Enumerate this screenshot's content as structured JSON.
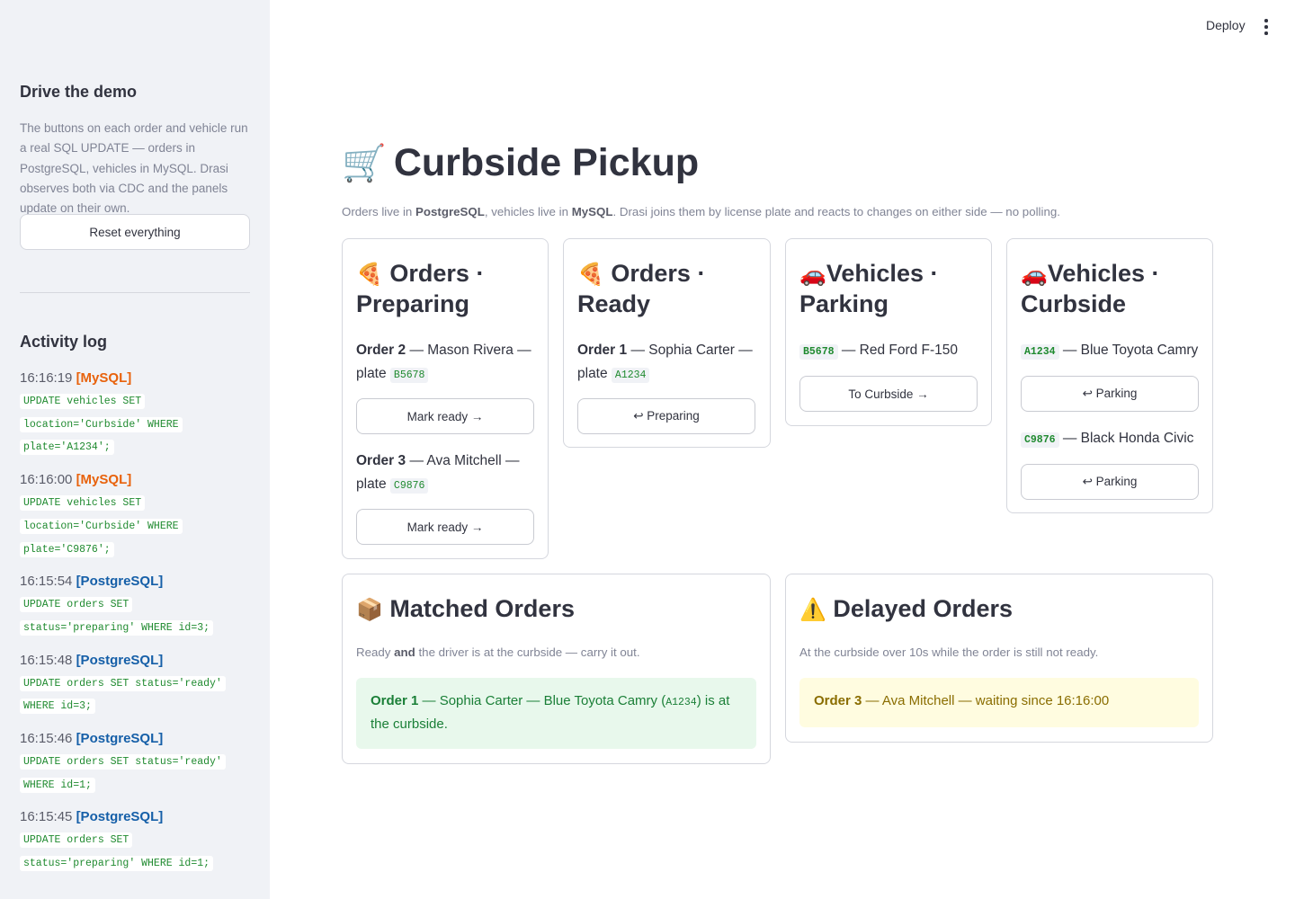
{
  "topbar": {
    "deploy_label": "Deploy",
    "menu_icon": "more-vertical-icon"
  },
  "sidebar": {
    "title": "Drive the demo",
    "description": "The buttons on each order and vehicle run a real SQL UPDATE — orders in PostgreSQL, vehicles in MySQL. Drasi observes both via CDC and the panels update on their own.",
    "reset_label": "Reset everything",
    "log_title": "Activity log",
    "log": [
      {
        "time": "16:16:19",
        "source": "[MySQL]",
        "sql_lines": [
          "UPDATE vehicles SET",
          "location='Curbside' WHERE",
          "plate='A1234';"
        ]
      },
      {
        "time": "16:16:00",
        "source": "[MySQL]",
        "sql_lines": [
          "UPDATE vehicles SET",
          "location='Curbside' WHERE",
          "plate='C9876';"
        ]
      },
      {
        "time": "16:15:54",
        "source": "[PostgreSQL]",
        "sql_lines": [
          "UPDATE orders SET",
          "status='preparing' WHERE id=3;"
        ]
      },
      {
        "time": "16:15:48",
        "source": "[PostgreSQL]",
        "sql_lines": [
          "UPDATE orders SET status='ready'",
          "WHERE id=3;"
        ]
      },
      {
        "time": "16:15:46",
        "source": "[PostgreSQL]",
        "sql_lines": [
          "UPDATE orders SET status='ready'",
          "WHERE id=1;"
        ]
      },
      {
        "time": "16:15:45",
        "source": "[PostgreSQL]",
        "sql_lines": [
          "UPDATE orders SET",
          "status='preparing' WHERE id=1;"
        ]
      }
    ]
  },
  "main": {
    "title": "Curbside Pickup",
    "title_icon": "shopping-cart-icon",
    "subtitle": {
      "pre": "Orders live in ",
      "db1": "PostgreSQL",
      "mid": ", vehicles live in ",
      "db2": "MySQL",
      "post": ". Drasi joins them by license plate and reacts to changes on either side — no polling."
    }
  },
  "panels": {
    "preparing": {
      "emoji": "🍕",
      "title_l1": "Orders ·",
      "title_l2": "Preparing",
      "items": [
        {
          "order": "Order 2",
          "name": " — Mason Rivera —",
          "plate_label": "plate ",
          "plate": "B5678",
          "button": "Mark ready →"
        },
        {
          "order": "Order 3",
          "name": " — Ava Mitchell —",
          "plate_label": "plate ",
          "plate": "C9876",
          "button": "Mark ready →"
        }
      ]
    },
    "ready": {
      "emoji": "🍕",
      "title_l1": "Orders ·",
      "title_l2": "Ready",
      "items": [
        {
          "order": "Order 1",
          "name": " — Sophia Carter —",
          "plate_label": "plate ",
          "plate": "A1234",
          "button": "↩ Preparing"
        }
      ]
    },
    "parking": {
      "emoji": "🚗",
      "title_l1": "Vehicles ·",
      "title_l2": "Parking",
      "items": [
        {
          "plate": "B5678",
          "desc": " — Red Ford F-150",
          "button": "To Curbside →"
        }
      ]
    },
    "curbside": {
      "emoji": "🚗",
      "title_l1": "Vehicles ·",
      "title_l2": "Curbside",
      "items": [
        {
          "plate": "A1234",
          "desc": " — Blue Toyota Camry",
          "button": "↩ Parking"
        },
        {
          "plate": "C9876",
          "desc": " — Black Honda Civic",
          "button": "↩ Parking"
        }
      ]
    },
    "matched": {
      "emoji": "📦",
      "title": "Matched Orders",
      "desc_pre": "Ready ",
      "desc_bold": "and",
      "desc_post": " the driver is at the curbside — carry it out.",
      "alert": {
        "order": "Order 1",
        "text1": " — Sophia Carter — Blue Toyota Camry (",
        "plate": "A1234",
        "text2": ") is at the curbside."
      }
    },
    "delayed": {
      "emoji": "⚠️",
      "title": "Delayed Orders",
      "desc": "At the curbside over 10s while the order is still not ready.",
      "alert": {
        "order": "Order 3",
        "text": " — Ava Mitchell — waiting since 16:16:00"
      }
    }
  },
  "colors": {
    "mysql": "#e8620c",
    "postgres": "#155fa8",
    "success_bg": "#e8f8ec",
    "warning_bg": "#fffce0"
  }
}
